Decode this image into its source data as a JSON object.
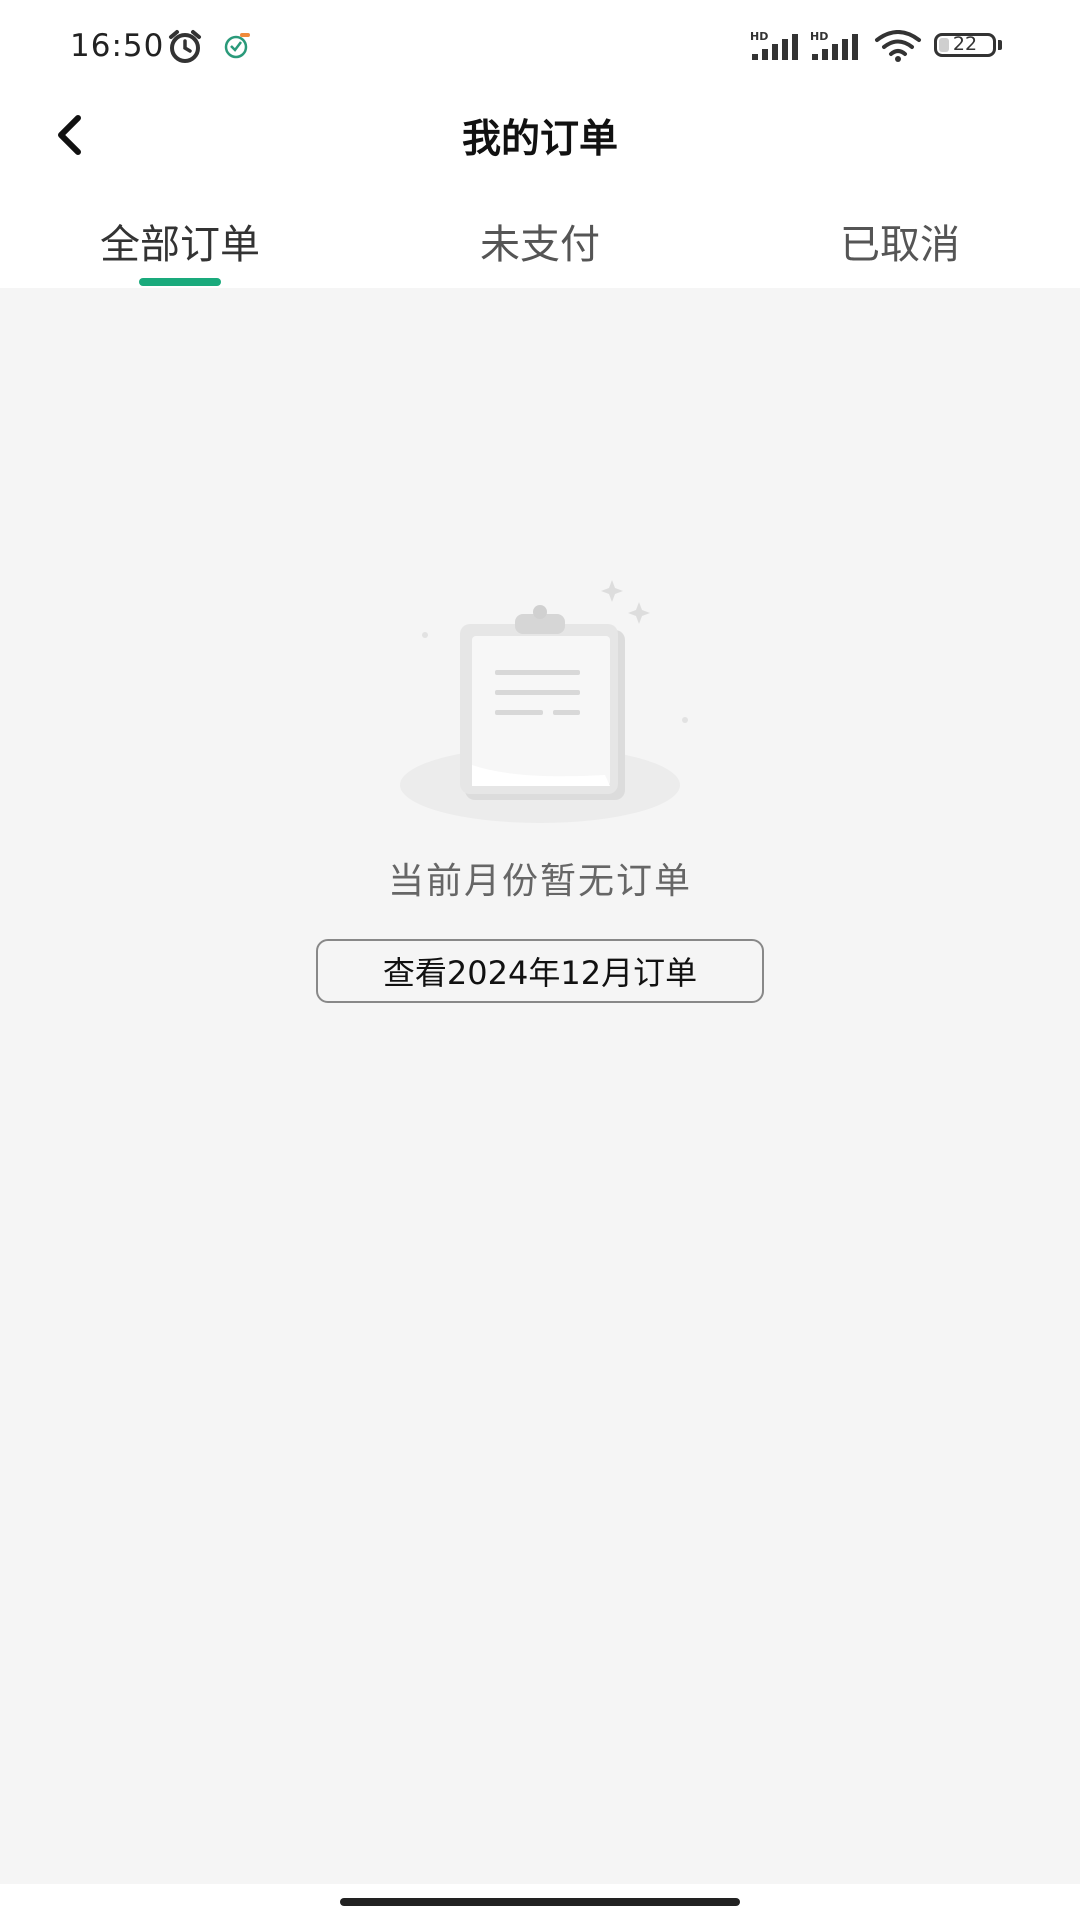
{
  "status_bar": {
    "time": "16:50",
    "battery_level": "22",
    "signal_label_1": "HD",
    "signal_label_2": "HD",
    "icons": [
      "alarm-icon",
      "app-notification-icon",
      "signal-icon",
      "signal-icon",
      "wifi-icon",
      "battery-icon"
    ]
  },
  "header": {
    "title": "我的订单",
    "back_icon": "chevron-left-icon"
  },
  "tabs": [
    {
      "label": "全部订单",
      "active": true
    },
    {
      "label": "未支付",
      "active": false
    },
    {
      "label": "已取消",
      "active": false
    }
  ],
  "empty_state": {
    "illustration": "empty-clipboard-icon",
    "message": "当前月份暂无订单",
    "button_label": "查看2024年12月订单"
  },
  "colors": {
    "accent": "#1aaa7c",
    "background": "#f5f5f5",
    "header_background": "#ffffff"
  }
}
